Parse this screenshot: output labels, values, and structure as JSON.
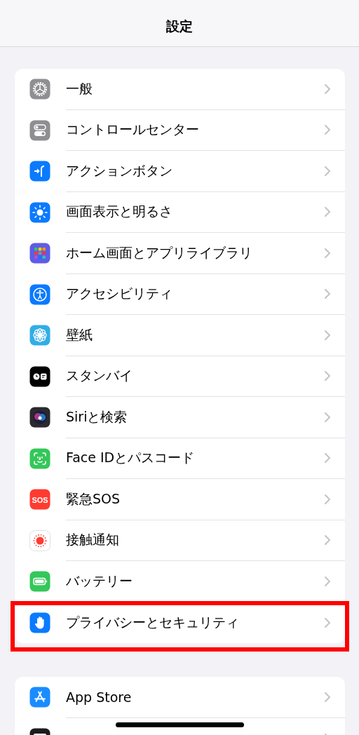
{
  "header": {
    "title": "設定"
  },
  "groups": [
    {
      "items": [
        {
          "label": "一般",
          "highlighted": false
        },
        {
          "label": "コントロールセンター",
          "highlighted": false
        },
        {
          "label": "アクションボタン",
          "highlighted": false
        },
        {
          "label": "画面表示と明るさ",
          "highlighted": false
        },
        {
          "label": "ホーム画面とアプリライブラリ",
          "highlighted": false
        },
        {
          "label": "アクセシビリティ",
          "highlighted": false
        },
        {
          "label": "壁紙",
          "highlighted": false
        },
        {
          "label": "スタンバイ",
          "highlighted": false
        },
        {
          "label": "Siriと検索",
          "highlighted": false
        },
        {
          "label": "Face IDとパスコード",
          "highlighted": false
        },
        {
          "label": "緊急SOS",
          "highlighted": false,
          "icon_text": "SOS"
        },
        {
          "label": "接触通知",
          "highlighted": false
        },
        {
          "label": "バッテリー",
          "highlighted": false
        },
        {
          "label": "プライバシーとセキュリティ",
          "highlighted": true
        }
      ]
    },
    {
      "items": [
        {
          "label": "App Store",
          "highlighted": false
        },
        {
          "highlighted": false
        }
      ]
    }
  ]
}
